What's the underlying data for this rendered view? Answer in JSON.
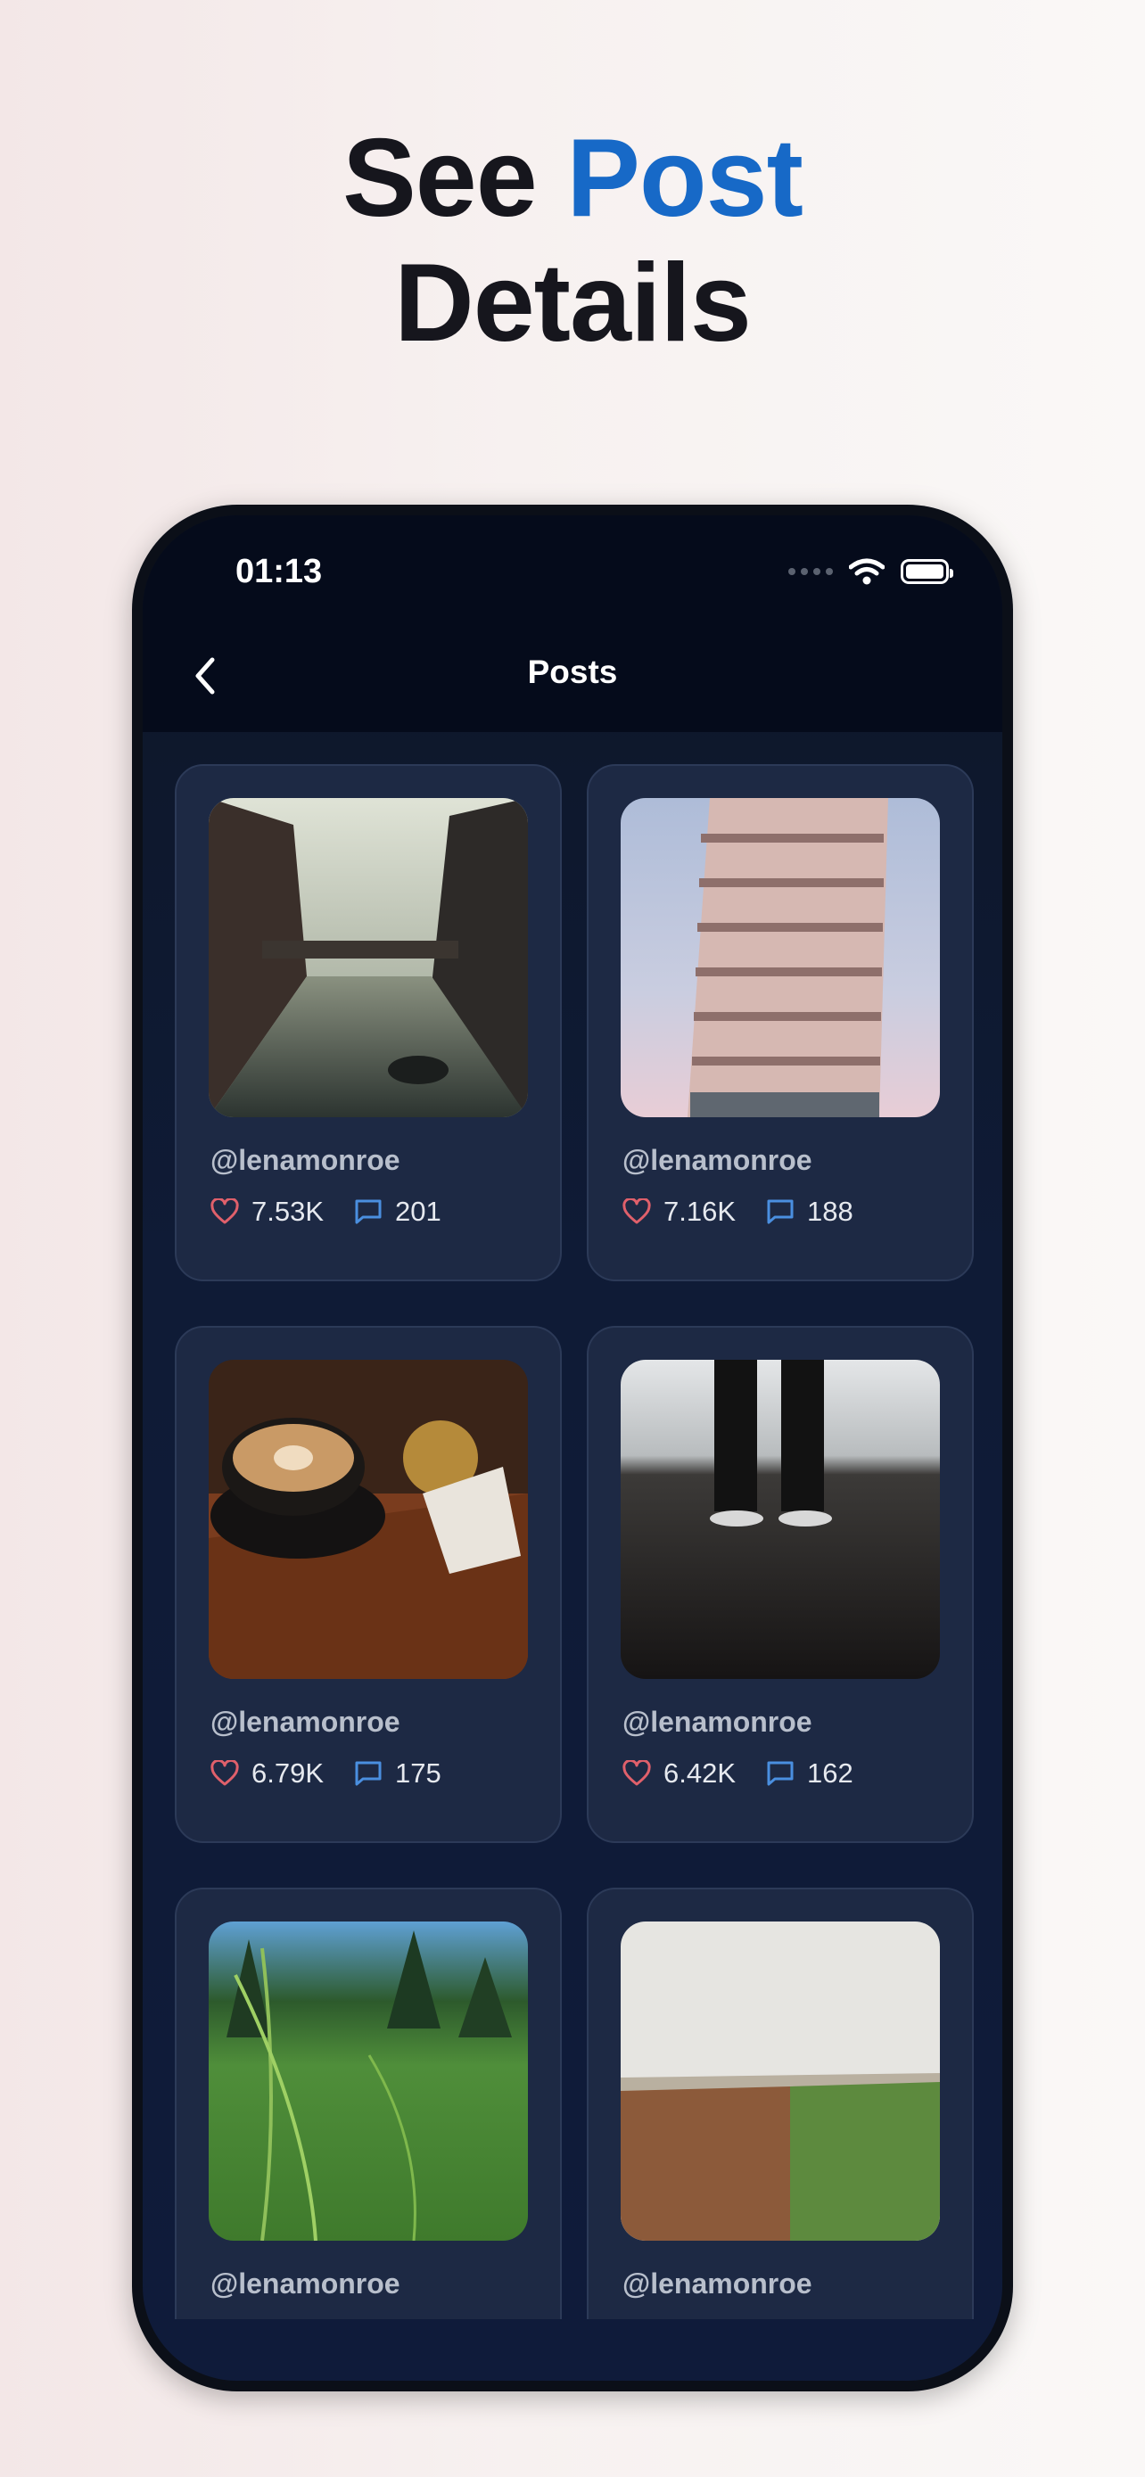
{
  "headline": {
    "line1_prefix": "See ",
    "line1_accent": "Post",
    "line2": "Details"
  },
  "status_bar": {
    "time": "01:13"
  },
  "nav": {
    "title": "Posts"
  },
  "posts": [
    {
      "author": "@lenamonroe",
      "likes": "7.53K",
      "comments": "201",
      "image": "canal-city-photo"
    },
    {
      "author": "@lenamonroe",
      "likes": "7.16K",
      "comments": "188",
      "image": "leaning-tower-photo"
    },
    {
      "author": "@lenamonroe",
      "likes": "6.79K",
      "comments": "175",
      "image": "latte-cup-photo"
    },
    {
      "author": "@lenamonroe",
      "likes": "6.42K",
      "comments": "162",
      "image": "legs-standing-photo"
    },
    {
      "author": "@lenamonroe",
      "image": "grass-field-photo"
    },
    {
      "author": "@lenamonroe",
      "image": "farmland-photo"
    }
  ],
  "colors": {
    "accent": "#1769c7",
    "like": "#e0606b",
    "comment": "#4a8fe0",
    "card": "#1d2944"
  }
}
